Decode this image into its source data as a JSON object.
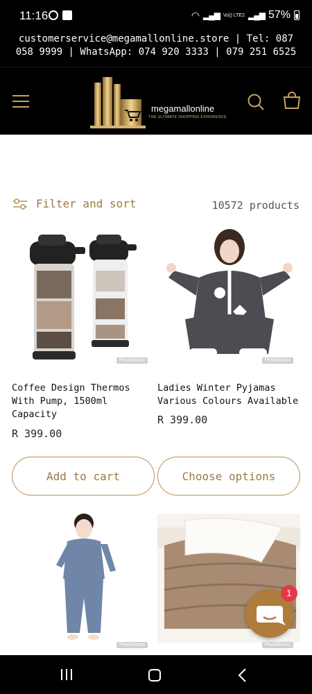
{
  "status_bar": {
    "time": "11:16",
    "volte_label": "Vo)) LTE2",
    "battery": "57%"
  },
  "announcement": {
    "text": "customerservice@megamallonline.store | Tel: 087 058 9999 | WhatsApp: 074 920 3333 | 079 251 6525"
  },
  "header": {
    "logo_name": "megamallonline",
    "logo_tagline": "THE ULTIMATE SHOPPING EXPERIENCE",
    "accent_color": "#c9a25f"
  },
  "collection": {
    "filter_label": "Filter and sort",
    "product_count": "10572 products"
  },
  "products": [
    {
      "title": "Coffee Design Thermos With Pump, 1500ml Capacity",
      "price": "R 399.00",
      "button": "Add to cart",
      "watermark": "PhotoRoom"
    },
    {
      "title": "Ladies Winter Pyjamas Various Colours Available",
      "price": "R 399.00",
      "button": "Choose options",
      "watermark": "PhotoRoom"
    },
    {
      "watermark": "PhotoRoom"
    },
    {
      "watermark": "PhotoRoom"
    }
  ],
  "chat": {
    "badge_count": "1"
  }
}
